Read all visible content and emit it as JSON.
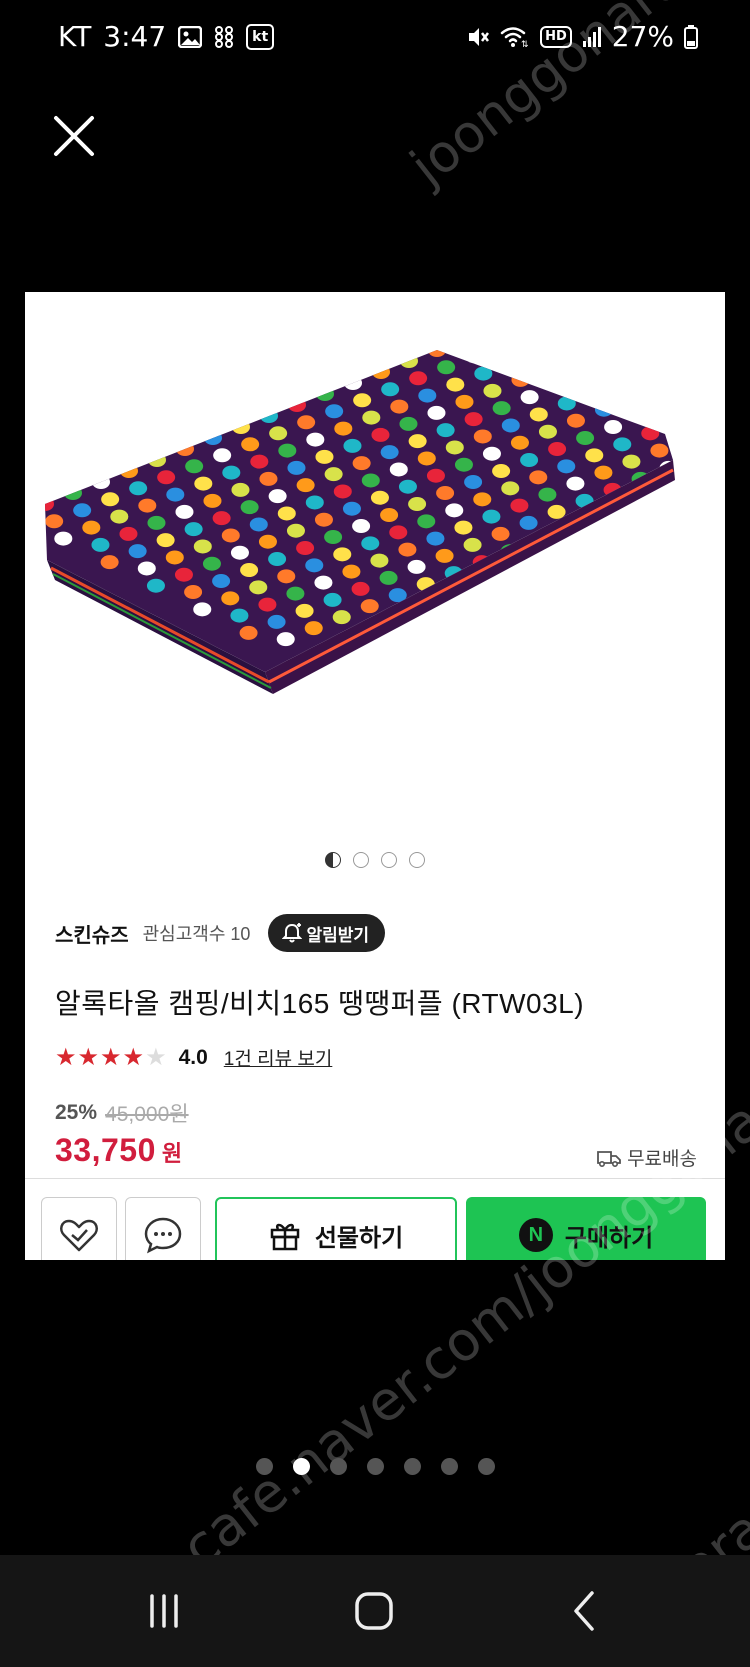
{
  "status_bar": {
    "carrier": "KT",
    "time": "3:47",
    "kt_badge": "kt",
    "hd_badge": "HD",
    "battery": "27%"
  },
  "watermark": {
    "line1": "joonggonara",
    "line2": "cafe.naver.com/joonggonara"
  },
  "product": {
    "image_description": "polka-dot-towel",
    "image_pager": {
      "count": 4,
      "active": 0
    },
    "store_name": "스킨슈즈",
    "followers_label": "관심고객수 10",
    "notify_label": "알림받기",
    "title": "알록타올 캠핑/비치165 땡땡퍼플 (RTW03L)",
    "rating": {
      "stars": 4,
      "max": 5,
      "value": "4.0"
    },
    "review_link": "1건 리뷰 보기",
    "discount": "25%",
    "original_price": "45,000원",
    "price": "33,750",
    "currency": "원",
    "shipping": "무료배송"
  },
  "actions": {
    "gift_label": "선물하기",
    "buy_label": "구매하기",
    "n_logo": "N"
  },
  "gallery_pager": {
    "count": 7,
    "active": 1
  },
  "colors": {
    "price_red": "#d11d3d",
    "star_red": "#d8282f",
    "naver_green": "#1ec453",
    "towel_base": "#3a1650"
  }
}
